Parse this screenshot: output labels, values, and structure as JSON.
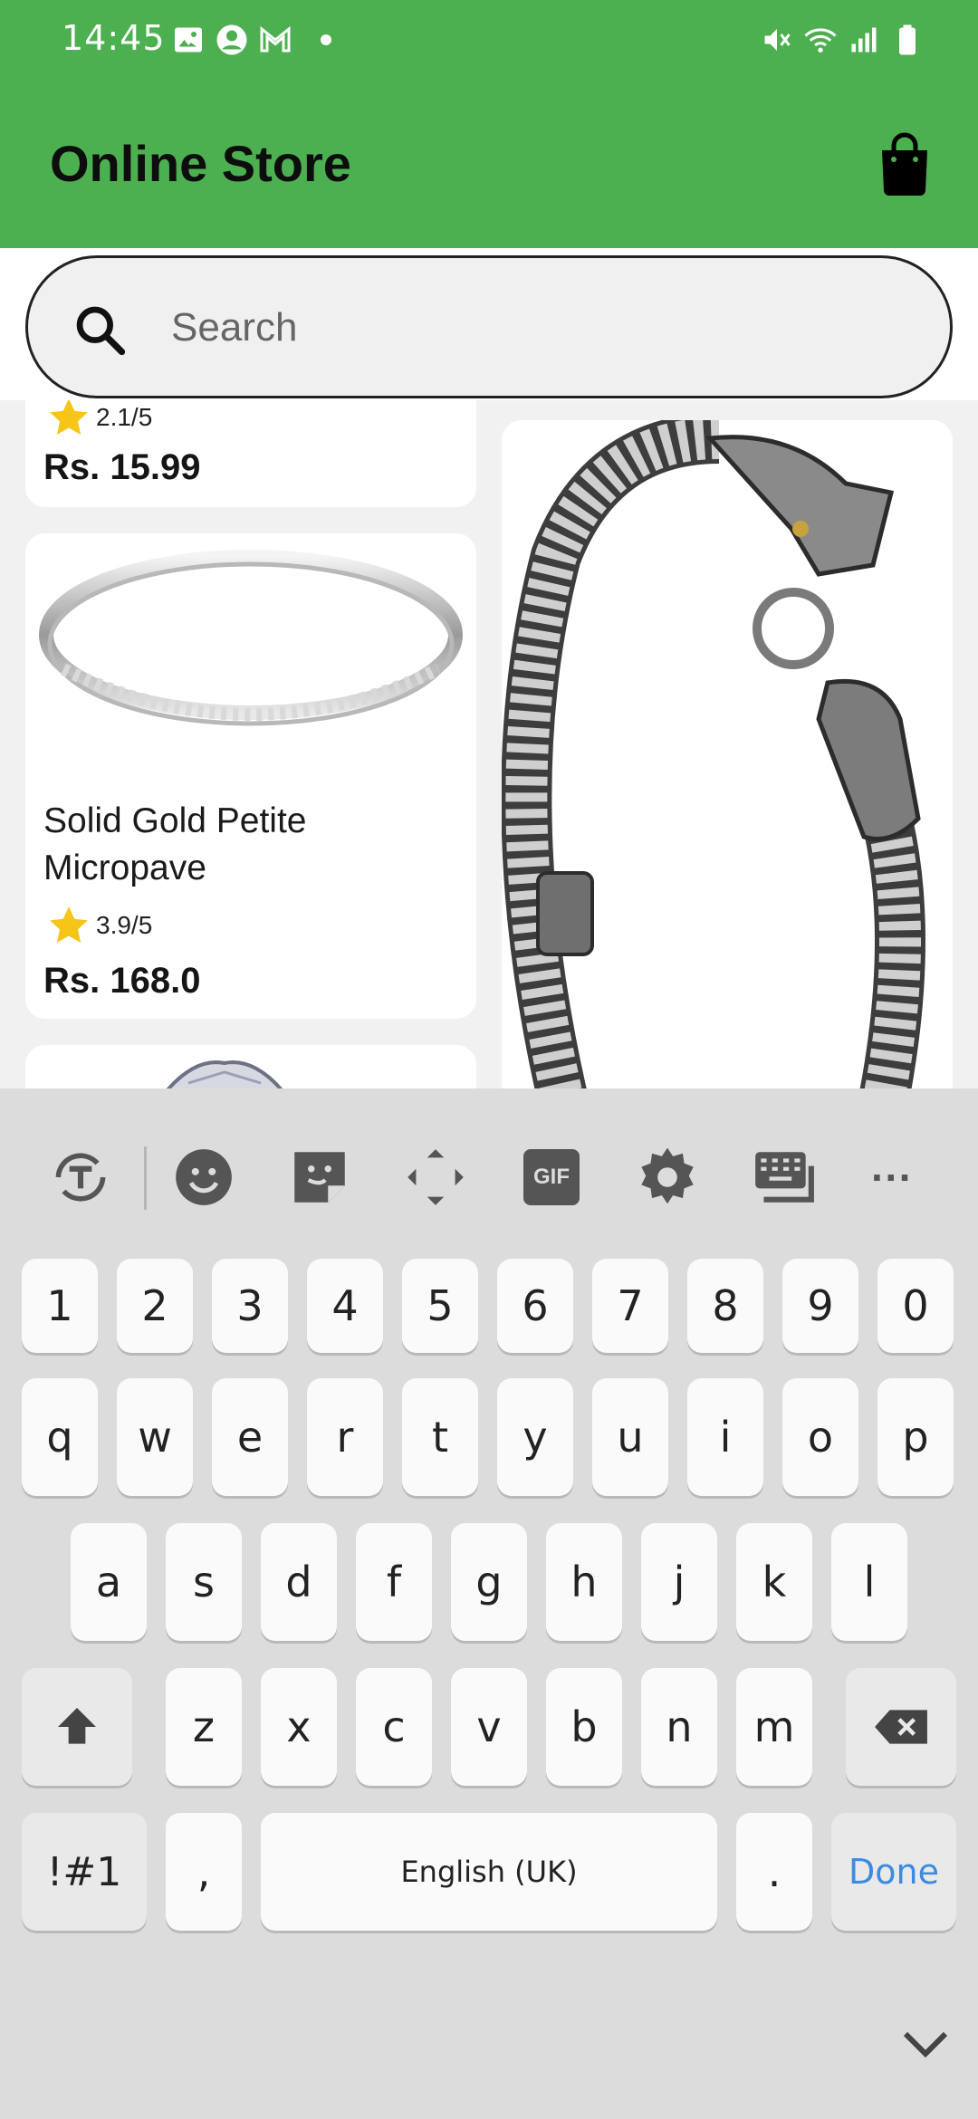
{
  "status_bar": {
    "time": "14:45",
    "left_icons": [
      "gallery-icon",
      "account-icon",
      "gmail-icon",
      "dot-icon"
    ],
    "right_icons": [
      "mute-icon",
      "wifi-icon",
      "signal-icon",
      "battery-icon"
    ]
  },
  "app_bar": {
    "title": "Online Store",
    "cart_icon": "shopping-bag-icon",
    "background": "#4caf50"
  },
  "search": {
    "placeholder": "Search",
    "value": ""
  },
  "products": [
    {
      "rating": "2.1/5",
      "price": "Rs. 15.99"
    },
    {
      "name": "Solid Gold Petite Micropave",
      "rating": "3.9/5",
      "price": "Rs. 168.0"
    },
    {
      "image": "dragon-bracelet"
    },
    {
      "image": "diamond-ring"
    }
  ],
  "keyboard": {
    "toolbar": [
      "translate-icon",
      "emoji-icon",
      "sticker-icon",
      "move-icon",
      "gif-icon",
      "settings-icon",
      "keyboard-icon",
      "more-icon"
    ],
    "gif_label": "GIF",
    "more_label": "···",
    "row_numbers": [
      "1",
      "2",
      "3",
      "4",
      "5",
      "6",
      "7",
      "8",
      "9",
      "0"
    ],
    "row1": [
      "q",
      "w",
      "e",
      "r",
      "t",
      "y",
      "u",
      "i",
      "o",
      "p"
    ],
    "row2": [
      "a",
      "s",
      "d",
      "f",
      "g",
      "h",
      "j",
      "k",
      "l"
    ],
    "row3": [
      "z",
      "x",
      "c",
      "v",
      "b",
      "n",
      "m"
    ],
    "symbols_label": "!#1",
    "comma": ",",
    "space_label": "English (UK)",
    "period": ".",
    "done_label": "Done",
    "accent_color": "#3c8be0"
  }
}
